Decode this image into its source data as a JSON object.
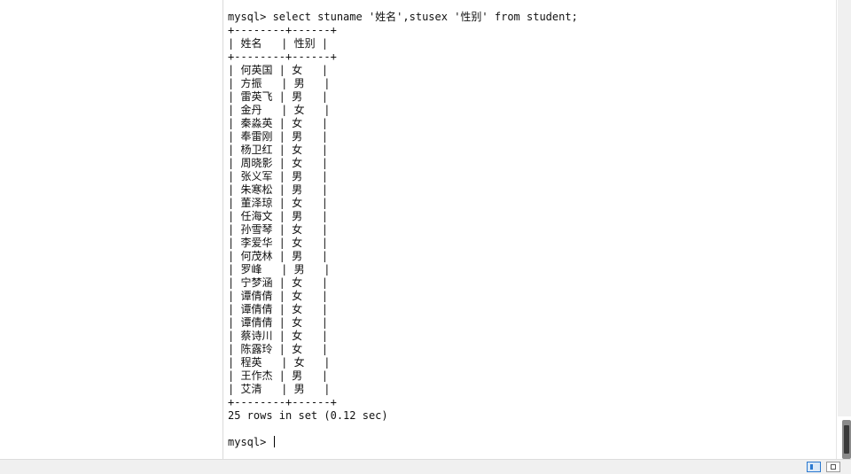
{
  "terminal": {
    "command_prompt": "mysql> ",
    "command": "select stuname '姓名',stusex '性别' from student;",
    "table_top_border": "+--------+------+",
    "table_header": "| 姓名   | 性别 |",
    "table_header_border": "+--------+------+",
    "rows": [
      "| 何英国 | 女   |",
      "| 方振   | 男   |",
      "| 雷英飞 | 男   |",
      "| 金丹   | 女   |",
      "| 秦淼英 | 女   |",
      "| 奉雷刚 | 男   |",
      "| 杨卫红 | 女   |",
      "| 周晓影 | 女   |",
      "| 张义军 | 男   |",
      "| 朱寒松 | 男   |",
      "| 董泽琼 | 女   |",
      "| 任海文 | 男   |",
      "| 孙雪琴 | 女   |",
      "| 李爱华 | 女   |",
      "| 何茂林 | 男   |",
      "| 罗峰   | 男   |",
      "| 宁梦涵 | 女   |",
      "| 谭倩倩 | 女   |",
      "| 谭倩倩 | 女   |",
      "| 谭倩倩 | 女   |",
      "| 蔡诗川 | 女   |",
      "| 陈露玲 | 女   |",
      "| 程英   | 女   |",
      "| 王作杰 | 男   |",
      "| 艾清   | 男   |"
    ],
    "table_bottom_border": "+--------+------+",
    "result_summary": "25 rows in set (0.12 sec)",
    "final_prompt": "mysql> "
  },
  "colors": {
    "terminal_bg": "#ffffff",
    "text": "#111111",
    "statusbar_bg": "#f0f0f0",
    "accent": "#2b79d0"
  }
}
